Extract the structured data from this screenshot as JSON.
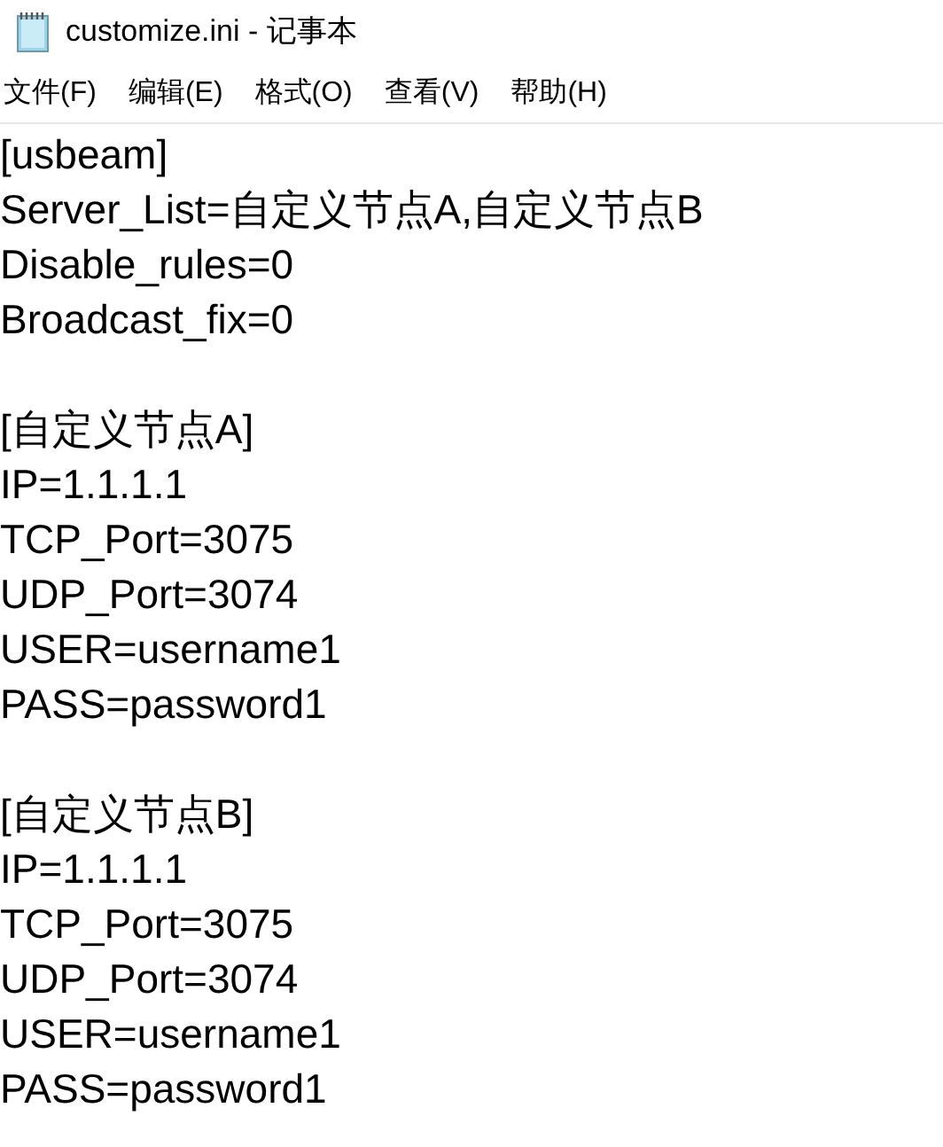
{
  "window": {
    "title": "customize.ini - 记事本"
  },
  "menu": [
    "文件(F)",
    "编辑(E)",
    "格式(O)",
    "查看(V)",
    "帮助(H)"
  ],
  "editor": {
    "blocks": [
      {
        "lines": [
          "[usbeam]",
          "Server_List=自定义节点A,自定义节点B",
          "Disable_rules=0",
          "Broadcast_fix=0"
        ]
      },
      {
        "lines": [
          "[自定义节点A]",
          "IP=1.1.1.1",
          "TCP_Port=3075",
          "UDP_Port=3074",
          "USER=username1",
          "PASS=password1"
        ]
      },
      {
        "lines": [
          "[自定义节点B]",
          "IP=1.1.1.1",
          "TCP_Port=3075",
          "UDP_Port=3074",
          "USER=username1",
          "PASS=password1"
        ]
      }
    ]
  }
}
